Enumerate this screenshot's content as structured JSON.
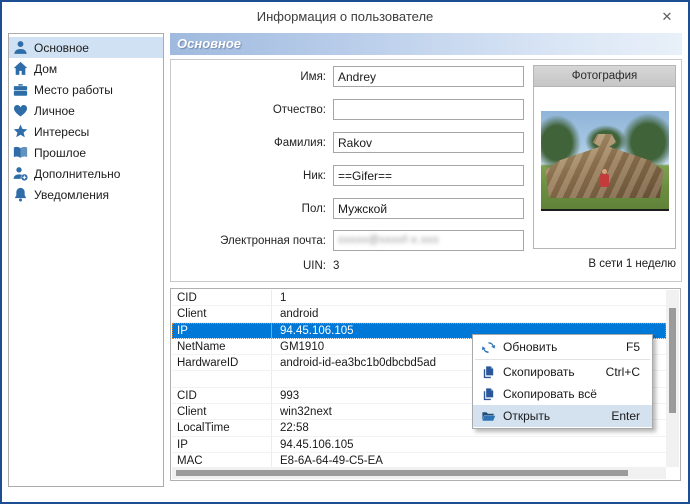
{
  "window": {
    "title": "Информация о пользователе",
    "close_glyph": "✕"
  },
  "sidebar": {
    "items": [
      {
        "label": "Основное",
        "icon": "user-icon",
        "selected": true
      },
      {
        "label": "Дом",
        "icon": "home-icon",
        "selected": false
      },
      {
        "label": "Место работы",
        "icon": "briefcase-icon",
        "selected": false
      },
      {
        "label": "Личное",
        "icon": "heart-icon",
        "selected": false
      },
      {
        "label": "Интересы",
        "icon": "star-icon",
        "selected": false
      },
      {
        "label": "Прошлое",
        "icon": "book-icon",
        "selected": false
      },
      {
        "label": "Дополнительно",
        "icon": "user-plus-icon",
        "selected": false
      },
      {
        "label": "Уведомления",
        "icon": "bell-icon",
        "selected": false
      }
    ]
  },
  "main": {
    "section_header": "Основное",
    "form": {
      "fields": [
        {
          "label": "Имя:",
          "value": "Andrey"
        },
        {
          "label": "Отчество:",
          "value": ""
        },
        {
          "label": "Фамилия:",
          "value": "Rakov"
        },
        {
          "label": "Ник:",
          "value": "==Gifer=="
        },
        {
          "label": "Пол:",
          "value": "Мужской"
        },
        {
          "label": "Электронная почта:",
          "value": "",
          "redacted": true,
          "masked_value": "xxxxx@xxxxf-x.xxx"
        }
      ],
      "uin_label": "UIN:",
      "uin_value": "3"
    },
    "photo": {
      "header": "Фотография",
      "status": "В сети 1 неделю"
    },
    "connection_table": {
      "rows": [
        {
          "key": "CID",
          "value": "1",
          "selected": false
        },
        {
          "key": "Client",
          "value": "android",
          "selected": false
        },
        {
          "key": "IP",
          "value": "94.45.106.105",
          "selected": true
        },
        {
          "key": "NetName",
          "value": "GM1910",
          "selected": false
        },
        {
          "key": "HardwareID",
          "value": "android-id-ea3bc1b0dbcbd5ad",
          "selected": false
        },
        {
          "key": "",
          "value": "",
          "selected": false
        },
        {
          "key": "CID",
          "value": "993",
          "selected": false
        },
        {
          "key": "Client",
          "value": "win32next",
          "selected": false
        },
        {
          "key": "LocalTime",
          "value": "22:58",
          "selected": false
        },
        {
          "key": "IP",
          "value": "94.45.106.105",
          "selected": false
        },
        {
          "key": "MAC",
          "value": "E8-6A-64-49-C5-EA",
          "selected": false
        }
      ]
    },
    "context_menu": {
      "items": [
        {
          "label": "Обновить",
          "shortcut": "F5",
          "icon": "refresh-icon",
          "highlighted": false
        },
        {
          "label": "Скопировать",
          "shortcut": "Ctrl+C",
          "icon": "copy-icon",
          "highlighted": false
        },
        {
          "label": "Скопировать всё",
          "shortcut": "",
          "icon": "copy-icon",
          "highlighted": false
        },
        {
          "label": "Открыть",
          "shortcut": "Enter",
          "icon": "folder-open-icon",
          "highlighted": true
        }
      ]
    }
  },
  "colors": {
    "window_border": "#1d4e91",
    "icon_blue": "#2f6da8",
    "selection_blue": "#0078d7",
    "sidebar_selected": "#cfe1f3",
    "menu_highlight": "#d4e1ef",
    "header_gradient_start": "#9fbade",
    "header_gradient_end": "#e8f0f9"
  }
}
